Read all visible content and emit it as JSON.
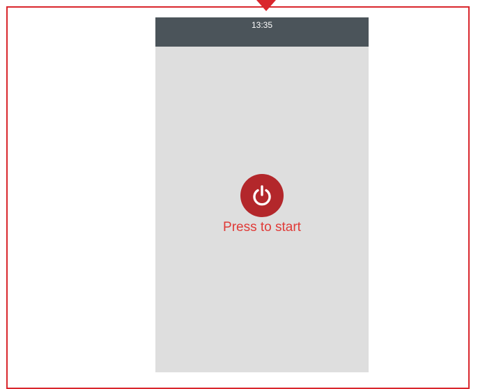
{
  "status_bar": {
    "time": "13:35"
  },
  "start_screen": {
    "icon": "power-icon",
    "label": "Press to start"
  },
  "colors": {
    "frame": "#d9262c",
    "status_bar_bg": "#4b545a",
    "screen_bg": "#dedede",
    "power_button": "#b3272b",
    "label_text": "#e03a37"
  }
}
